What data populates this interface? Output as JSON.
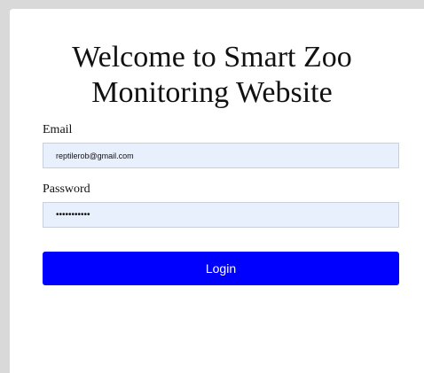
{
  "page": {
    "title": "Welcome to Smart Zoo Monitoring Website"
  },
  "form": {
    "email_label": "Email",
    "email_value": "reptilerob@gmail.com",
    "password_label": "Password",
    "password_value": "sssssssssss",
    "login_label": "Login"
  },
  "colors": {
    "accent": "#0000ff",
    "field_background": "#e8f0fe",
    "outer_background": "#d9d9d9"
  }
}
